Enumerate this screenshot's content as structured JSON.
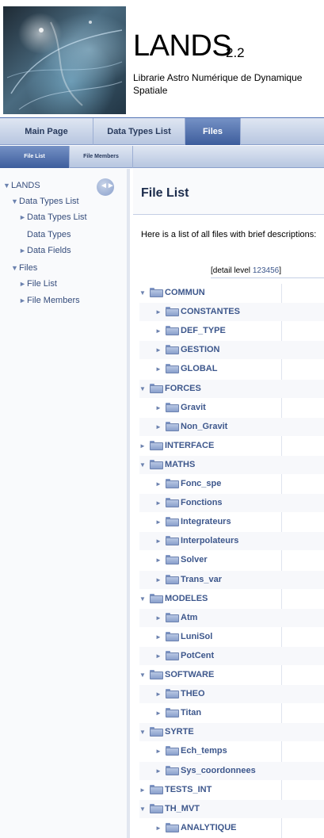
{
  "header": {
    "project_name": "LANDS",
    "project_number": "2.2",
    "project_brief": "Librarie Astro Numérique de Dynamique Spatiale"
  },
  "main_tabs": [
    {
      "label": "Main Page",
      "selected": false
    },
    {
      "label": "Data Types List",
      "selected": false
    },
    {
      "label": "Files",
      "selected": true
    }
  ],
  "sub_tabs": [
    {
      "label": "File List",
      "selected": true
    },
    {
      "label": "File Members",
      "selected": false
    }
  ],
  "sidebar": {
    "items": [
      {
        "label": "LANDS",
        "arrow": "▼"
      },
      {
        "label": "Data Types List",
        "arrow": "▼"
      },
      {
        "label": "Data Types List",
        "arrow": "►"
      },
      {
        "label": "Data Types",
        "arrow": ""
      },
      {
        "label": "Data Fields",
        "arrow": "►"
      },
      {
        "label": "Files",
        "arrow": "▼"
      },
      {
        "label": "File List",
        "arrow": "►"
      },
      {
        "label": "File Members",
        "arrow": "►"
      }
    ],
    "sync_icon": "sync-icon"
  },
  "main": {
    "title": "File List",
    "intro": "Here is a list of all files with brief descriptions:",
    "detail_level_label": "[detail level",
    "detail_levels": [
      "1",
      "2",
      "3",
      "4",
      "5",
      "6"
    ],
    "detail_level_close": "]"
  },
  "dirs": [
    {
      "name": "COMMUN",
      "depth": 0,
      "expanded": true
    },
    {
      "name": "CONSTANTES",
      "depth": 1,
      "expanded": false
    },
    {
      "name": "DEF_TYPE",
      "depth": 1,
      "expanded": false
    },
    {
      "name": "GESTION",
      "depth": 1,
      "expanded": false
    },
    {
      "name": "GLOBAL",
      "depth": 1,
      "expanded": false
    },
    {
      "name": "FORCES",
      "depth": 0,
      "expanded": true
    },
    {
      "name": "Gravit",
      "depth": 1,
      "expanded": false
    },
    {
      "name": "Non_Gravit",
      "depth": 1,
      "expanded": false
    },
    {
      "name": "INTERFACE",
      "depth": 0,
      "expanded": false
    },
    {
      "name": "MATHS",
      "depth": 0,
      "expanded": true
    },
    {
      "name": "Fonc_spe",
      "depth": 1,
      "expanded": false
    },
    {
      "name": "Fonctions",
      "depth": 1,
      "expanded": false
    },
    {
      "name": "Integrateurs",
      "depth": 1,
      "expanded": false
    },
    {
      "name": "Interpolateurs",
      "depth": 1,
      "expanded": false
    },
    {
      "name": "Solver",
      "depth": 1,
      "expanded": false
    },
    {
      "name": "Trans_var",
      "depth": 1,
      "expanded": false
    },
    {
      "name": "MODELES",
      "depth": 0,
      "expanded": true
    },
    {
      "name": "Atm",
      "depth": 1,
      "expanded": false
    },
    {
      "name": "LuniSol",
      "depth": 1,
      "expanded": false
    },
    {
      "name": "PotCent",
      "depth": 1,
      "expanded": false
    },
    {
      "name": "SOFTWARE",
      "depth": 0,
      "expanded": true
    },
    {
      "name": "THEO",
      "depth": 1,
      "expanded": false
    },
    {
      "name": "Titan",
      "depth": 1,
      "expanded": false
    },
    {
      "name": "SYRTE",
      "depth": 0,
      "expanded": true
    },
    {
      "name": "Ech_temps",
      "depth": 1,
      "expanded": false
    },
    {
      "name": "Sys_coordonnees",
      "depth": 1,
      "expanded": false
    },
    {
      "name": "TESTS_INT",
      "depth": 0,
      "expanded": false
    },
    {
      "name": "TH_MVT",
      "depth": 0,
      "expanded": true
    },
    {
      "name": "ANALYTIQUE",
      "depth": 1,
      "expanded": false
    }
  ],
  "colors": {
    "accent": "#3d5d9c",
    "link": "#3d578c",
    "nav_text": "#364d7c"
  }
}
